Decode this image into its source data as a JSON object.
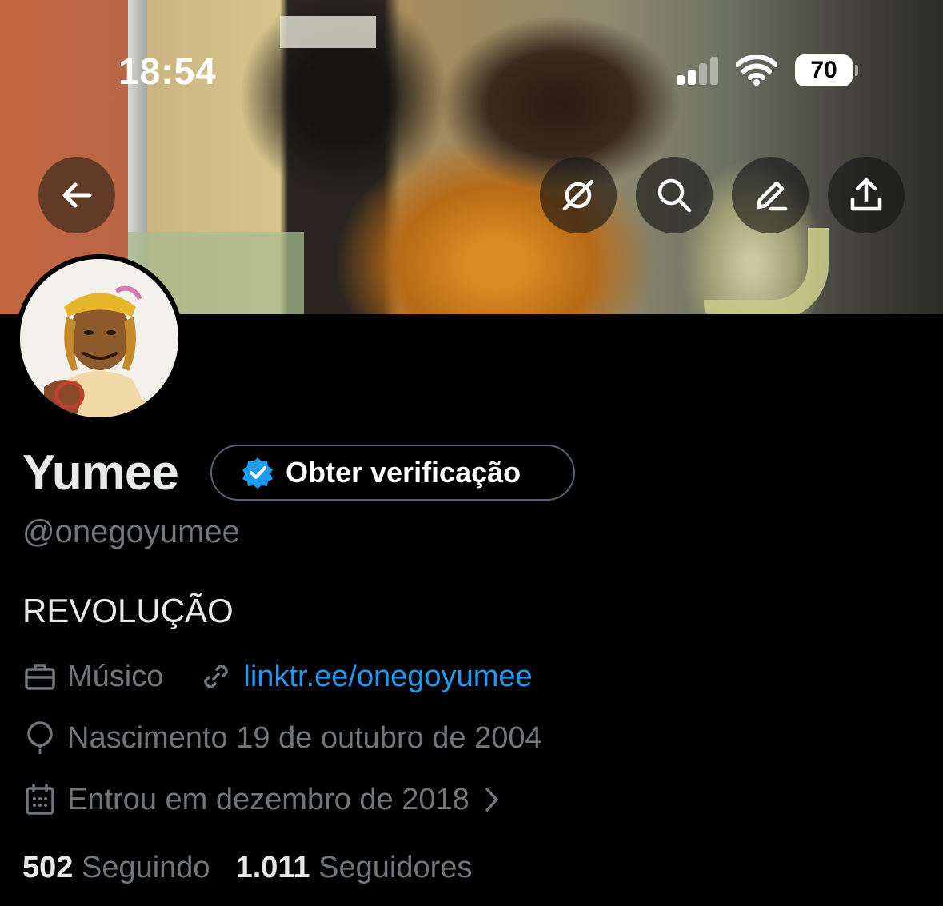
{
  "status_bar": {
    "time": "18:54",
    "battery": "70",
    "signal_bars_active": 2,
    "signal_bars_total": 4
  },
  "header_actions": {
    "back": "arrow-left-icon",
    "items": [
      "grok-icon",
      "search-icon",
      "edit-icon",
      "share-icon"
    ]
  },
  "profile": {
    "name": "Yumee",
    "verify_label": "Obter verificação",
    "handle": "@onegoyumee",
    "bio": "REVOLUÇÃO",
    "profession": "Músico",
    "link": "linktr.ee/onegoyumee",
    "birth": "Nascimento 19 de outubro de 2004",
    "joined": "Entrou em dezembro de 2018",
    "following_count": "502",
    "following_label": "Seguindo",
    "followers_count": "1.011",
    "followers_label": "Seguidores"
  },
  "colors": {
    "background": "#000000",
    "text_primary": "#e7e9ea",
    "text_secondary": "#71767b",
    "link": "#1d9bf0",
    "verified_badge": "#1d9bf0"
  }
}
